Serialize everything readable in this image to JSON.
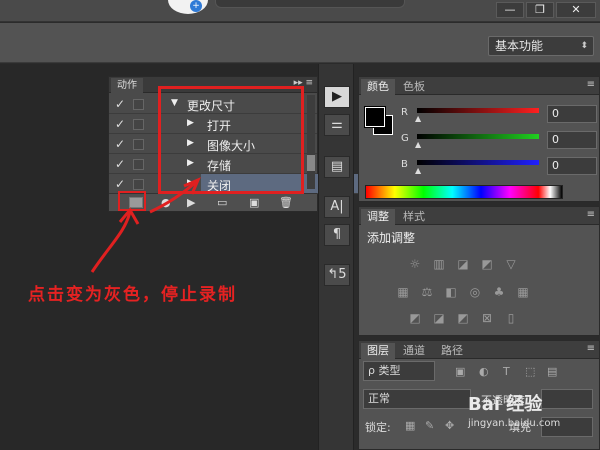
{
  "workspace": {
    "label": "基本功能",
    "arrow": "⬍"
  },
  "window_buttons": {
    "minimize": "—",
    "restore": "❐",
    "close": "✕"
  },
  "app": {
    "badge": "+"
  },
  "actions_panel": {
    "tab": "动作",
    "tab_icons": "▸▸ ≡",
    "rows": [
      {
        "check": "✓",
        "indent": 0,
        "triangle": "▼",
        "label": "更改尺寸"
      },
      {
        "check": "✓",
        "indent": 1,
        "triangle": "▶",
        "label": "打开"
      },
      {
        "check": "✓",
        "indent": 1,
        "triangle": "▶",
        "label": "图像大小"
      },
      {
        "check": "✓",
        "indent": 1,
        "triangle": "▶",
        "label": "存储"
      },
      {
        "check": "✓",
        "indent": 1,
        "triangle": "▶",
        "label": "关闭"
      }
    ],
    "bottom_icons": {
      "record": "●",
      "play": "▶",
      "folder": "▭",
      "new": "▣",
      "delete": "🗑"
    }
  },
  "annotation": {
    "text": "点击变为灰色，停止录制"
  },
  "tools": [
    "▶",
    "⚌",
    "▤",
    "A|",
    "¶",
    "↰5"
  ],
  "color_panel": {
    "tabs": [
      "颜色",
      "色板"
    ],
    "channels": [
      {
        "name": "R",
        "value": "0",
        "gradient": "#ff2020"
      },
      {
        "name": "G",
        "value": "0",
        "gradient": "#20d020"
      },
      {
        "name": "B",
        "value": "0",
        "gradient": "#2020ff"
      }
    ]
  },
  "adjustments_panel": {
    "tabs": [
      "调整",
      "样式"
    ],
    "title": "添加调整",
    "icons_row1": [
      "☼",
      "▥",
      "◪",
      "◩",
      "▽"
    ],
    "icons_row2": [
      "▦",
      "⚖",
      "◧",
      "◎",
      "♣",
      "▦"
    ],
    "icons_row3": [
      "◩",
      "◪",
      "◩",
      "⊠",
      "▯"
    ]
  },
  "layers_panel": {
    "tabs": [
      "图层",
      "通道",
      "路径"
    ],
    "filter": "ρ 类型",
    "blend_mode": "正常",
    "opacity_label": "不透明度",
    "lock_label": "锁定:",
    "fill_label": "填充"
  },
  "watermark": {
    "brand": "Bai 经验",
    "url": "jingyan.baidu.com"
  }
}
